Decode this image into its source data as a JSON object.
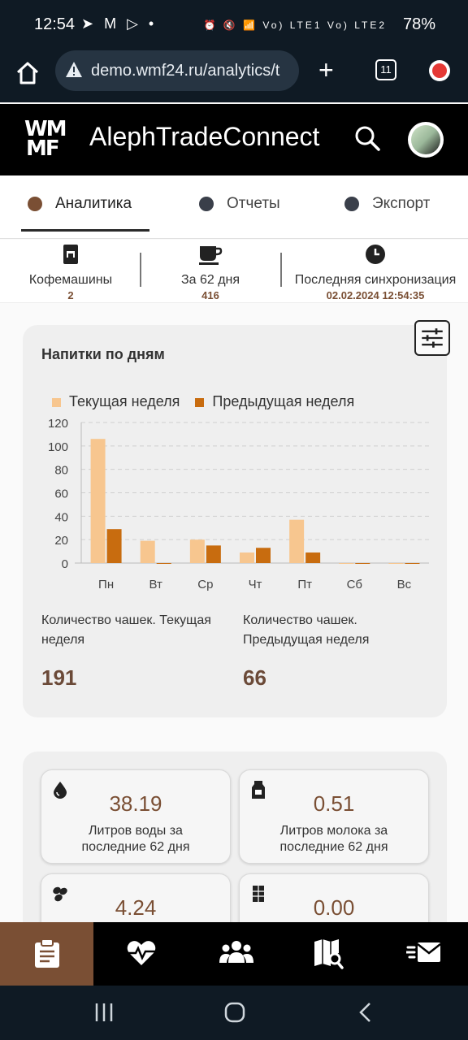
{
  "status_bar": {
    "time": "12:54",
    "left_icons": "➤ M ▷ •",
    "right_icons": "⏰ 🔇 📶 Vo) LTE1 Vo) LTE2",
    "battery": "78%"
  },
  "browser": {
    "url": "demo.wmf24.ru/analytics/t",
    "tab_count": "11"
  },
  "header": {
    "logo_top": "WM",
    "logo_bottom": "MF",
    "title": "AlephTradeConnect"
  },
  "tabs": [
    {
      "label": "Аналитика",
      "active": true
    },
    {
      "label": "Отчеты",
      "active": false
    },
    {
      "label": "Экспорт",
      "active": false
    }
  ],
  "summary": {
    "machines_label": "Кофемашины",
    "machines_value": "2",
    "period_label": "За 62 дня",
    "period_value": "416",
    "sync_label": "Последняя синхронизация",
    "sync_value": "02.02.2024 12:54:35"
  },
  "chart_card": {
    "title": "Напитки по дням",
    "stat_current_label": "Количество чашек. Текущая неделя",
    "stat_current_value": "191",
    "stat_previous_label": "Количество чашек. Предыдущая неделя",
    "stat_previous_value": "66"
  },
  "chart_data": {
    "type": "bar",
    "title": "Напитки по дням",
    "categories": [
      "Пн",
      "Вт",
      "Ср",
      "Чт",
      "Пт",
      "Сб",
      "Вс"
    ],
    "series": [
      {
        "name": "Текущая неделя",
        "color": "#f7c68f",
        "values": [
          106,
          19,
          20,
          9,
          37,
          0,
          0
        ]
      },
      {
        "name": "Предыдущая неделя",
        "color": "#c86c0f",
        "values": [
          29,
          0,
          15,
          13,
          9,
          0,
          0
        ]
      }
    ],
    "y_ticks": [
      0,
      20,
      40,
      60,
      80,
      100,
      120
    ],
    "ylim": [
      0,
      120
    ],
    "grid": true,
    "legend_position": "top"
  },
  "metrics": [
    {
      "icon": "water-drop-icon",
      "value": "38.19",
      "label_line1": "Литров воды за",
      "label_line2": "последние 62 дня"
    },
    {
      "icon": "milk-carton-icon",
      "value": "0.51",
      "label_line1": "Литров молока за",
      "label_line2": "последние 62 дня"
    },
    {
      "icon": "coffee-beans-icon",
      "value": "4.24",
      "label_line1": "",
      "label_line2": ""
    },
    {
      "icon": "chocolate-icon",
      "value": "0.00",
      "label_line1": "",
      "label_line2": ""
    }
  ],
  "bottom_nav": [
    {
      "icon": "clipboard-icon",
      "active": true
    },
    {
      "icon": "heartbeat-icon",
      "active": false
    },
    {
      "icon": "users-icon",
      "active": false
    },
    {
      "icon": "map-search-icon",
      "active": false
    },
    {
      "icon": "fast-mail-icon",
      "active": false
    }
  ],
  "colors": {
    "accent": "#7a4f34",
    "current_week": "#f7c68f",
    "previous_week": "#c86c0f"
  }
}
